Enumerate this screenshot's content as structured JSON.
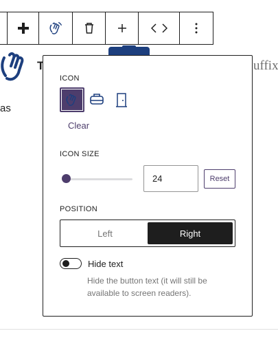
{
  "background": {
    "title_fragment": "T",
    "suffix_fragment": "uffix",
    "text_fragment": "as"
  },
  "toolbar": {
    "items": [
      {
        "name": "move-handle",
        "icon": "plus-bar-icon"
      },
      {
        "name": "block-icon",
        "icon": "waving-hand-icon"
      },
      {
        "name": "delete",
        "icon": "trash-icon"
      },
      {
        "name": "add",
        "icon": "plus-icon"
      },
      {
        "name": "html",
        "icon": "code-icon"
      },
      {
        "name": "more",
        "icon": "kebab-icon"
      }
    ]
  },
  "popover": {
    "icon_section": {
      "label": "ICON",
      "options": [
        "waving-hand-icon",
        "robot-icon",
        "door-icon"
      ],
      "selected": "waving-hand-icon",
      "clear_label": "Clear"
    },
    "icon_size": {
      "label": "ICON SIZE",
      "value": "24",
      "slider_fraction": 0.05,
      "reset_label": "Reset"
    },
    "position": {
      "label": "POSITION",
      "options": [
        "Left",
        "Right"
      ],
      "selected": "Right"
    },
    "hide_text": {
      "label": "Hide text",
      "enabled": false,
      "help": "Hide the button text (it will still be available to screen readers)."
    }
  },
  "colors": {
    "accent": "#4d3d6c",
    "text": "#1e1e1e",
    "muted": "#757575",
    "bg_icon": "#1d3f7e"
  }
}
